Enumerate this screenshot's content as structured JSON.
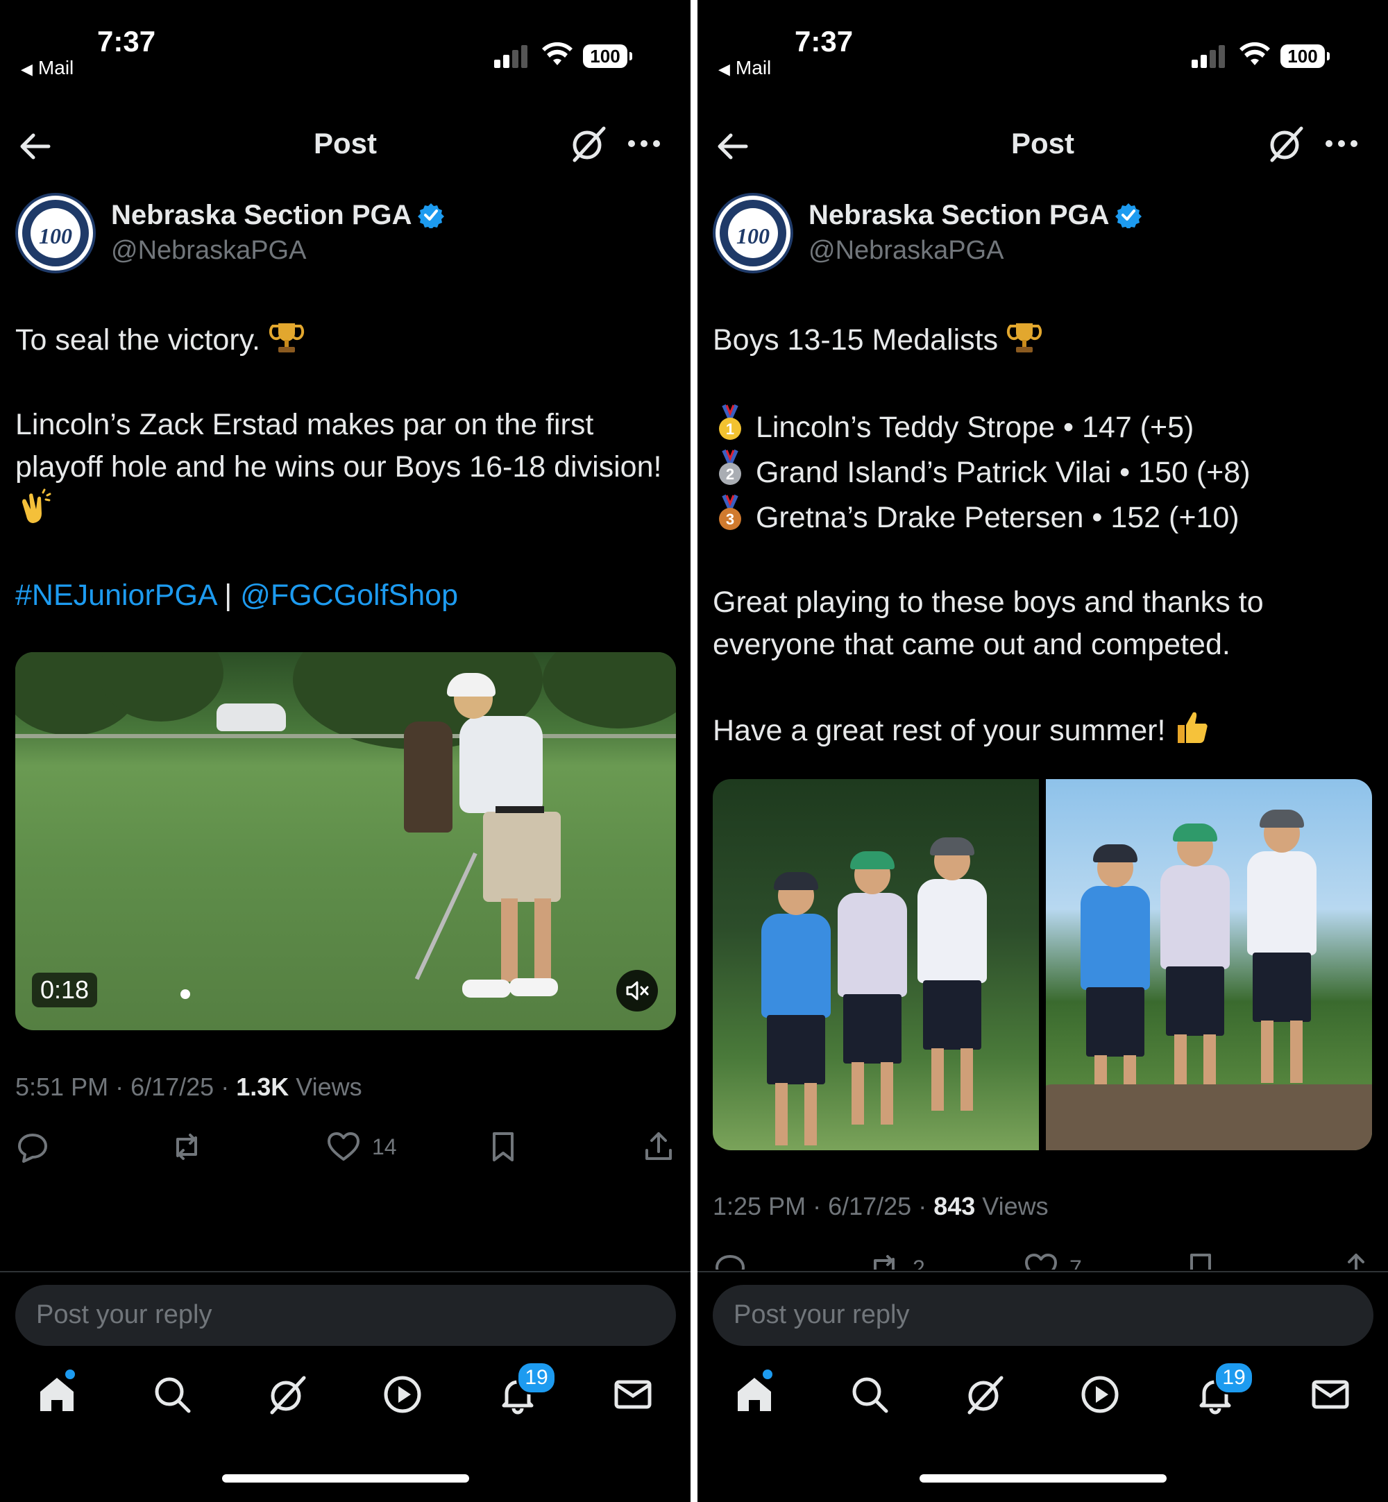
{
  "status_bar": {
    "time": "7:37",
    "back_app": "Mail",
    "battery": "100"
  },
  "header": {
    "title": "Post"
  },
  "author": {
    "name": "Nebraska Section PGA",
    "handle": "@NebraskaPGA",
    "avatar_text": "100"
  },
  "left_post": {
    "line1": "To seal the victory.",
    "line2": "Lincoln’s Zack Erstad makes par on the first playoff hole and he wins our Boys 16-18 division!",
    "hashtag": "#NEJuniorPGA",
    "separator": "|",
    "mention": "@FGCGolfShop",
    "video_duration": "0:18",
    "meta": {
      "time": "5:51 PM",
      "date": "6/17/25",
      "views_count": "1.3K",
      "views_label": "Views"
    },
    "actions": {
      "reply": "",
      "repost": "",
      "like": "14",
      "bookmark": "",
      "share": ""
    }
  },
  "right_post": {
    "heading": "Boys 13-15 Medalists",
    "medalists": [
      {
        "medal": "1",
        "text": "Lincoln’s Teddy Strope • 147 (+5)"
      },
      {
        "medal": "2",
        "text": "Grand Island’s Patrick Vilai • 150 (+8)"
      },
      {
        "medal": "3",
        "text": "Gretna’s Drake Petersen • 152 (+10)"
      }
    ],
    "para1": "Great playing to these boys and thanks to everyone that came out and competed.",
    "para2": "Have a great rest of your summer!",
    "meta": {
      "time": "1:25 PM",
      "date": "6/17/25",
      "views_count": "843",
      "views_label": "Views"
    },
    "actions": {
      "repost": "2",
      "like": "7"
    }
  },
  "reply": {
    "placeholder": "Post your reply"
  },
  "tabbar": {
    "notifications_badge": "19"
  },
  "icons": {
    "back": "arrow-left-icon",
    "grok": "grok-icon",
    "more": "more-horizontal-icon",
    "verified": "verified-badge-icon",
    "home": "home-icon",
    "search": "search-icon",
    "video": "play-circle-icon",
    "notifications": "bell-icon",
    "messages": "mail-icon",
    "trophy": "trophy-icon",
    "clap": "clapping-hands-icon",
    "thumbs": "thumbs-up-icon"
  },
  "colors": {
    "accent": "#1d9bf0",
    "text": "#e7e9ea",
    "muted": "#71767b",
    "background": "#000000"
  }
}
